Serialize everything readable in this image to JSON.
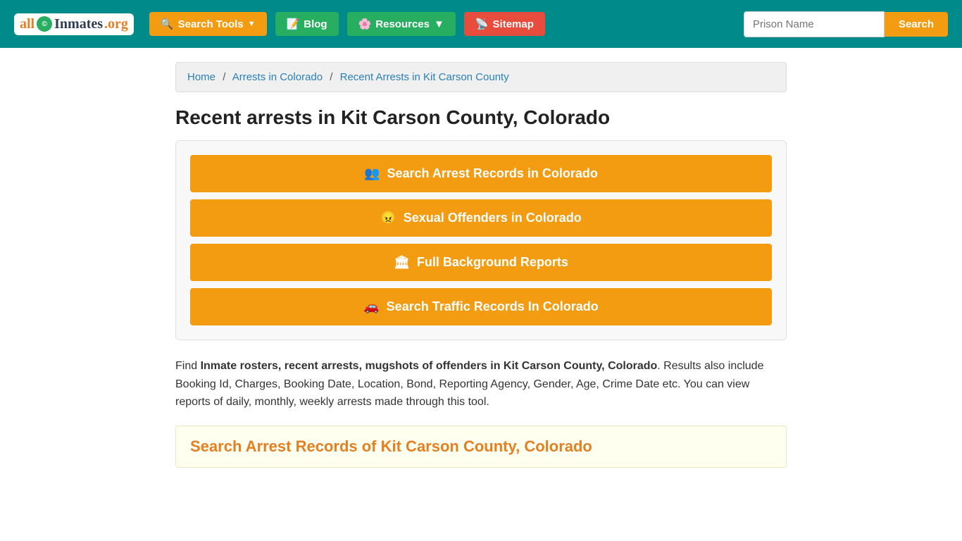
{
  "header": {
    "logo": {
      "part1": "all",
      "part2": "Inmates",
      "part3": ".org",
      "dot": "©"
    },
    "nav": [
      {
        "id": "search-tools",
        "label": "Search Tools",
        "icon": "search-nav-icon",
        "hasDropdown": true,
        "color": "orange"
      },
      {
        "id": "blog",
        "label": "Blog",
        "icon": "blog-icon",
        "hasDropdown": false,
        "color": "green"
      },
      {
        "id": "resources",
        "label": "Resources",
        "icon": "resources-icon",
        "hasDropdown": true,
        "color": "green"
      },
      {
        "id": "sitemap",
        "label": "Sitemap",
        "icon": "rss-icon",
        "hasDropdown": false,
        "color": "red"
      }
    ],
    "search": {
      "placeholder": "Prison Name",
      "button_label": "Search"
    }
  },
  "breadcrumb": {
    "items": [
      {
        "label": "Home",
        "href": "#"
      },
      {
        "label": "Arrests in Colorado",
        "href": "#"
      },
      {
        "label": "Recent Arrests in Kit Carson County",
        "href": "#",
        "current": true
      }
    ]
  },
  "page": {
    "title": "Recent arrests in Kit Carson County, Colorado",
    "action_buttons": [
      {
        "id": "search-arrest-records",
        "label": "Search Arrest Records in Colorado",
        "icon": "people-icon"
      },
      {
        "id": "sexual-offenders",
        "label": "Sexual Offenders in Colorado",
        "icon": "angry-icon"
      },
      {
        "id": "full-background-reports",
        "label": "Full Background Reports",
        "icon": "building-icon"
      },
      {
        "id": "search-traffic-records",
        "label": "Search Traffic Records In Colorado",
        "icon": "car-icon"
      }
    ],
    "description_prefix": "Find ",
    "description_bold": "Inmate rosters, recent arrests, mugshots of offenders in Kit Carson County, Colorado",
    "description_suffix": ". Results also include Booking Id, Charges, Booking Date, Location, Bond, Reporting Agency, Gender, Age, Crime Date etc. You can view reports of daily, monthly, weekly arrests made through this tool.",
    "section_heading": "Search Arrest Records of Kit Carson County, Colorado"
  }
}
